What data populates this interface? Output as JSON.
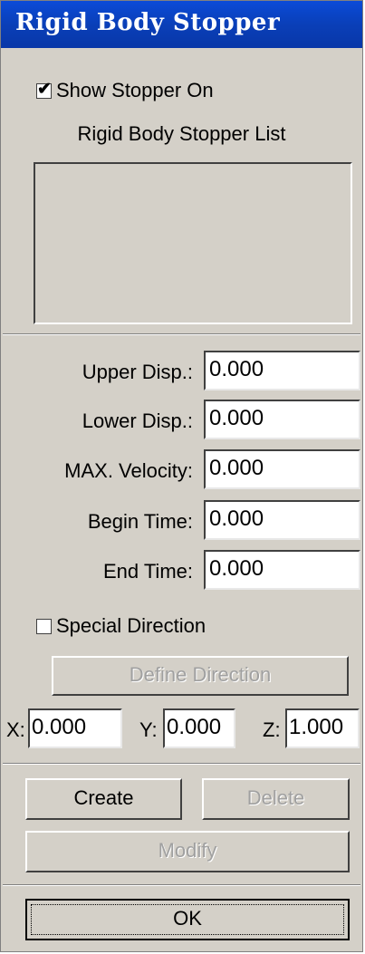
{
  "window": {
    "title": "Rigid Body Stopper"
  },
  "show_stopper": {
    "label": "Show Stopper On",
    "checked": true,
    "check_glyph": "✔"
  },
  "list": {
    "title": "Rigid Body Stopper List",
    "items": []
  },
  "fields": {
    "upper_disp": {
      "label": "Upper Disp.:",
      "value": "0.000"
    },
    "lower_disp": {
      "label": "Lower Disp.:",
      "value": "0.000"
    },
    "max_velocity": {
      "label": "MAX. Velocity:",
      "value": "0.000"
    },
    "begin_time": {
      "label": "Begin Time:",
      "value": "0.000"
    },
    "end_time": {
      "label": "End Time:",
      "value": "0.000"
    }
  },
  "special_direction": {
    "label": "Special Direction",
    "checked": false
  },
  "define_direction": {
    "label": "Define Direction",
    "enabled": false
  },
  "direction": {
    "x": {
      "label": "X:",
      "value": "0.000"
    },
    "y": {
      "label": "Y:",
      "value": "0.000"
    },
    "z": {
      "label": "Z:",
      "value": "1.000"
    }
  },
  "buttons": {
    "create": "Create",
    "delete": "Delete",
    "modify": "Modify",
    "ok": "OK"
  },
  "colors": {
    "title_bar": "#0a3fb8",
    "face": "#d4d0c8",
    "disabled_text": "#a0a0a0"
  }
}
